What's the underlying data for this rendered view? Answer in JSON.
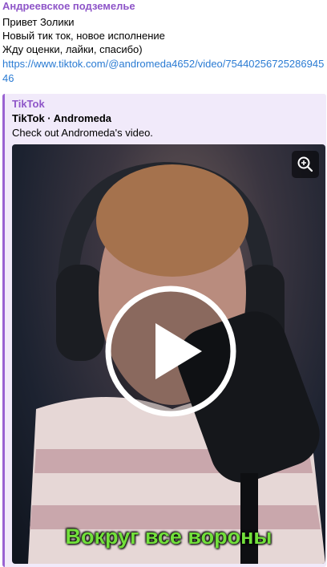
{
  "message": {
    "sender": "Андреевское подземелье",
    "lines": [
      "Привет Золики",
      "Новый тик ток, новое исполнение",
      "Жду оценки, лайки, спасибо)"
    ],
    "link": "https://www.tiktok.com/@andromeda4652/video/7544025672528694546"
  },
  "preview": {
    "site_name": "TikTok",
    "title": "TikTok · Andromeda",
    "description": "Check out Andromeda's video.",
    "zoom_icon": "zoom-in-icon",
    "play_icon": "play-icon",
    "video_caption": "Вокруг все вороны"
  },
  "colors": {
    "sender": "#8e55c8",
    "link": "#2a7bd3",
    "preview_bg": "#f1eafa",
    "preview_accent": "#9a63d2",
    "caption": "#72e03b"
  }
}
